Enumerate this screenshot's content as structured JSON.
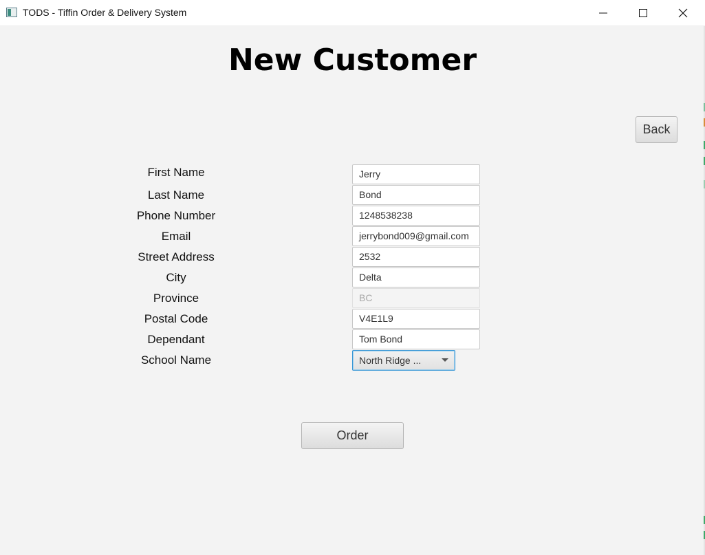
{
  "window": {
    "title": "TODS - Tiffin Order & Delivery System",
    "controls": [
      "minimize-icon",
      "maximize-icon",
      "close-icon"
    ]
  },
  "page": {
    "heading": "New Customer",
    "back_label": "Back",
    "order_label": "Order"
  },
  "form": {
    "fields": [
      {
        "label": "First Name",
        "value": "Jerry"
      },
      {
        "label": "Last Name",
        "value": "Bond"
      },
      {
        "label": "Phone Number",
        "value": "1248538238"
      },
      {
        "label": "Email",
        "value": "jerrybond009@gmail.com"
      },
      {
        "label": "Street Address",
        "value": "2532"
      },
      {
        "label": "City",
        "value": "Delta"
      },
      {
        "label": "Province",
        "value": "BC",
        "disabled": true
      },
      {
        "label": "Postal Code",
        "value": "V4E1L9"
      },
      {
        "label": "Dependant",
        "value": "Tom Bond"
      },
      {
        "label": "School Name",
        "value": "North Ridge ...",
        "type": "select"
      }
    ]
  },
  "colors": {
    "background": "#f3f3f3",
    "focus_border": "#3a98d6"
  }
}
